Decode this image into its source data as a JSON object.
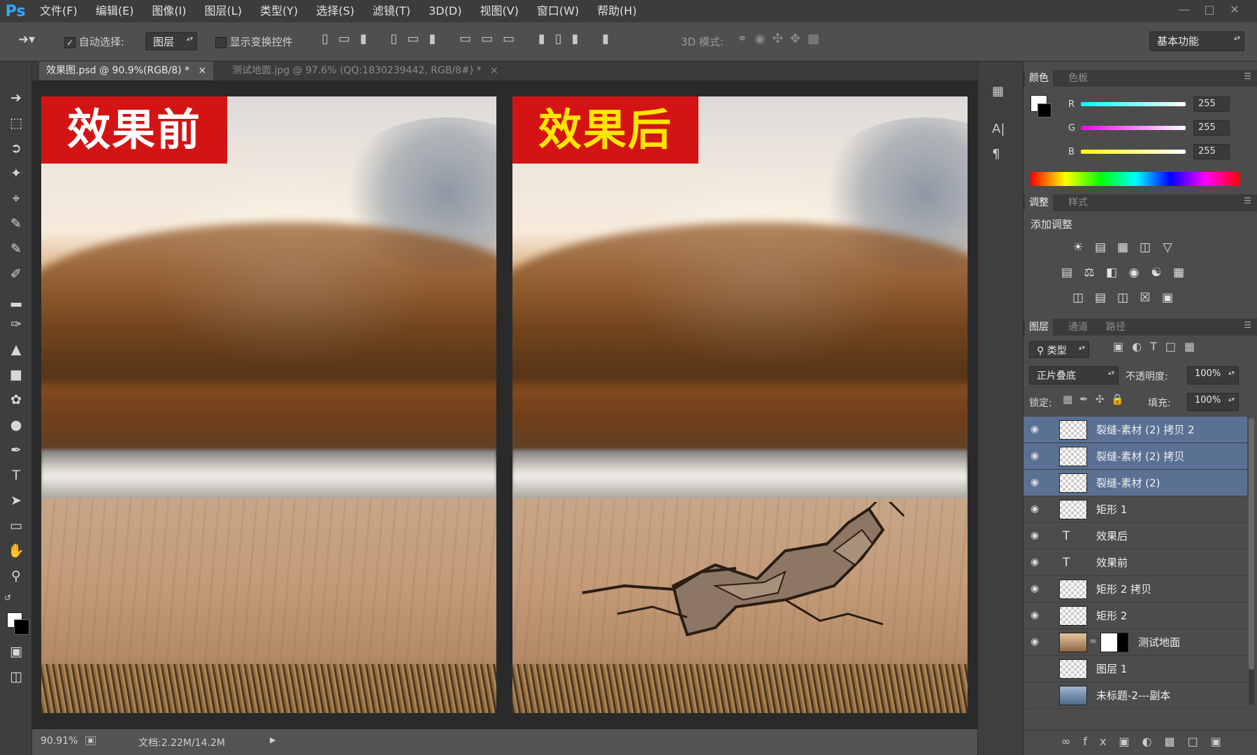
{
  "app": {
    "logo": "Ps"
  },
  "menu": [
    "文件(F)",
    "编辑(E)",
    "图像(I)",
    "图层(L)",
    "类型(Y)",
    "选择(S)",
    "滤镜(T)",
    "3D(D)",
    "视图(V)",
    "窗口(W)",
    "帮助(H)"
  ],
  "window_controls": {
    "minimize": "—",
    "restore": "□",
    "close": "✕"
  },
  "options": {
    "auto_select_label": "自动选择:",
    "auto_select_value": "图层",
    "show_transform_label": "显示变换控件",
    "mode_3d_label": "3D 模式:",
    "workspace": "基本功能"
  },
  "tabs": [
    {
      "label": "效果图.psd @ 90.9%(RGB/8) *",
      "close": "×",
      "active": true
    },
    {
      "label": "测试地面.jpg @ 97.6% (QQ:1830239442, RGB/8#) *",
      "close": "×",
      "active": false
    }
  ],
  "canvas": {
    "before_label": "效果前",
    "after_label": "效果后"
  },
  "status": {
    "zoom": "90.91%",
    "doc": "文档:2.22M/14.2M"
  },
  "color_panel": {
    "tabs": [
      "颜色",
      "色板"
    ],
    "r_label": "R",
    "g_label": "G",
    "b_label": "B",
    "r": "255",
    "g": "255",
    "b": "255"
  },
  "adjust_panel": {
    "tabs": [
      "调整",
      "样式"
    ],
    "title": "添加调整"
  },
  "layers_panel": {
    "tabs": [
      "图层",
      "通道",
      "路径"
    ],
    "filter_kind": "类型",
    "blend_mode": "正片叠底",
    "opacity_label": "不透明度:",
    "opacity": "100%",
    "lock_label": "锁定:",
    "fill_label": "填充:",
    "fill": "100%",
    "layers": [
      {
        "name": "裂缝-素材 (2) 拷贝 2",
        "type": "smart",
        "visible": true,
        "selected": true
      },
      {
        "name": "裂缝-素材 (2) 拷贝",
        "type": "smart",
        "visible": true,
        "selected": true
      },
      {
        "name": "裂缝-素材 (2)",
        "type": "smart",
        "visible": true,
        "selected": true
      },
      {
        "name": "矩形 1",
        "type": "smart",
        "visible": true,
        "selected": false
      },
      {
        "name": "效果后",
        "type": "text",
        "visible": true,
        "selected": false
      },
      {
        "name": "效果前",
        "type": "text",
        "visible": true,
        "selected": false
      },
      {
        "name": "矩形 2 拷贝",
        "type": "smart",
        "visible": true,
        "selected": false
      },
      {
        "name": "矩形 2",
        "type": "smart",
        "visible": true,
        "selected": false
      },
      {
        "name": "测试地面",
        "type": "masked",
        "visible": true,
        "selected": false
      },
      {
        "name": "图层 1",
        "type": "smart",
        "visible": false,
        "selected": false
      },
      {
        "name": "未标题-2---副本",
        "type": "smart",
        "visible": false,
        "selected": false
      }
    ]
  },
  "colors": {
    "selection": "#5a7193",
    "label_red": "#d41414",
    "label_yellow": "#ffe600"
  }
}
